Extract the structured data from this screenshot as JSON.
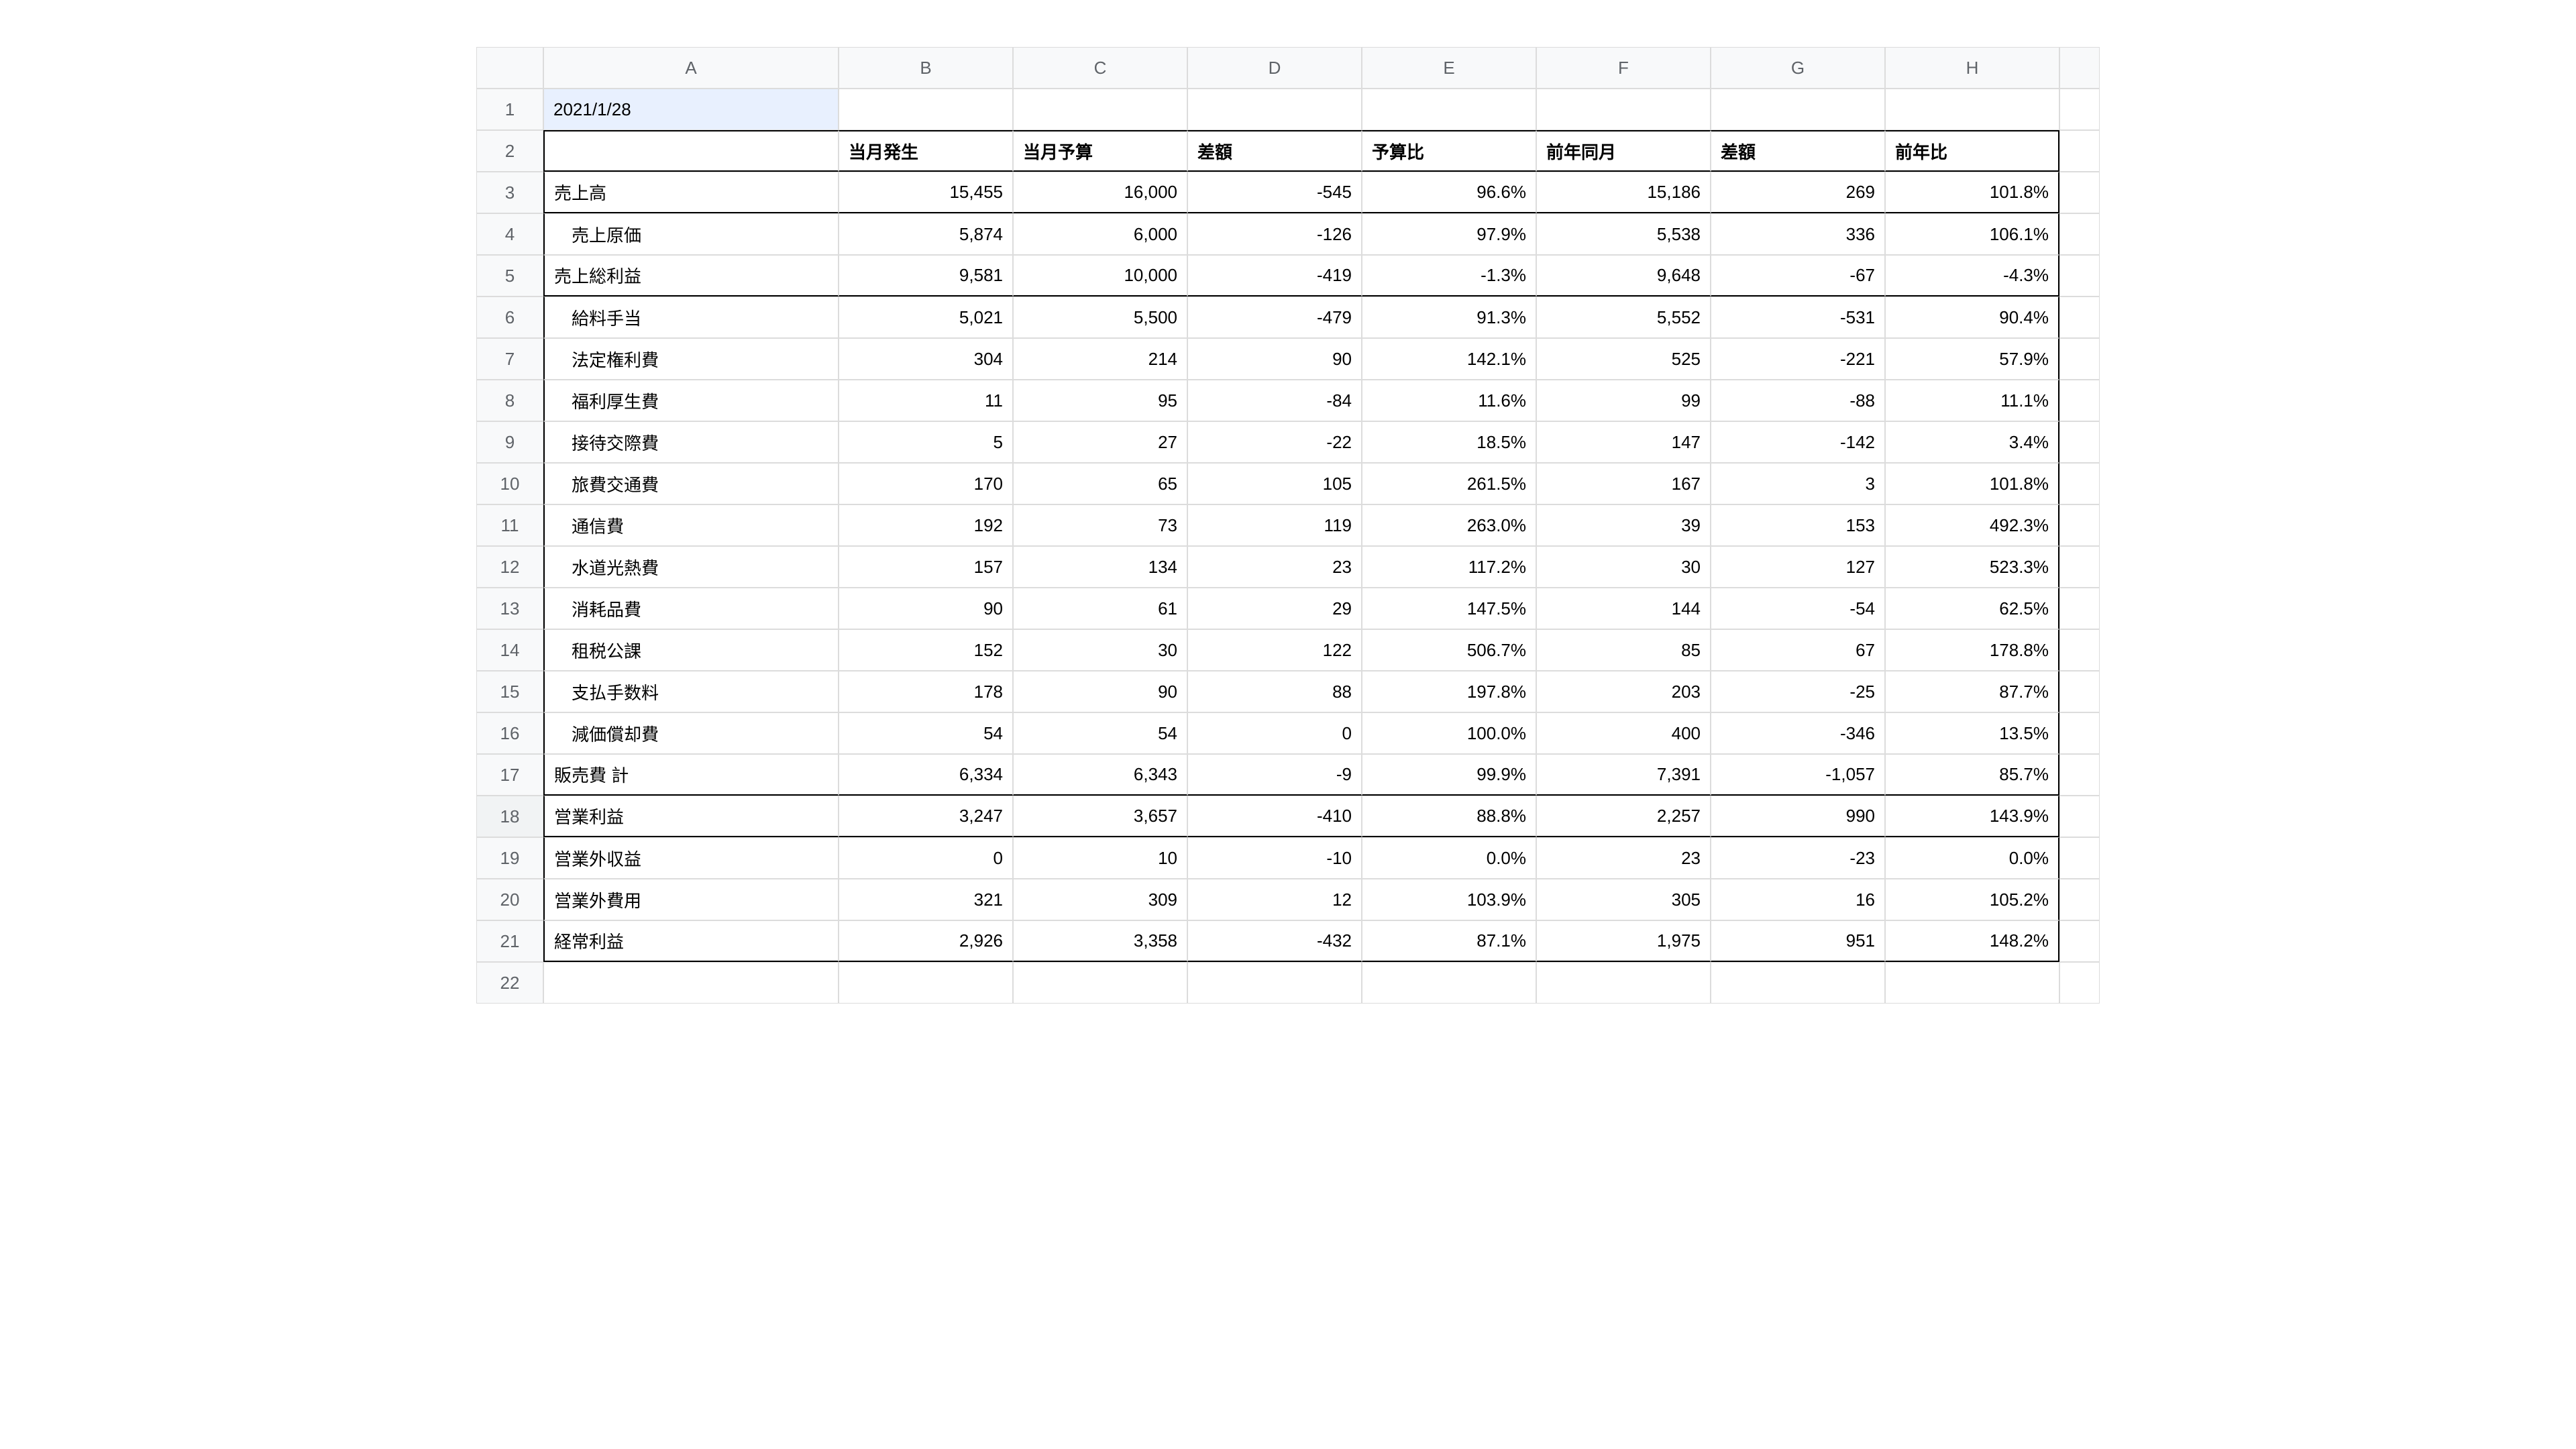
{
  "columns": [
    "",
    "A",
    "B",
    "C",
    "D",
    "E",
    "F",
    "G",
    "H",
    ""
  ],
  "date_cell": "2021/1/28",
  "headers": {
    "a": "",
    "b": "当月発生",
    "c": "当月予算",
    "d": "差額",
    "e": "予算比",
    "f": "前年同月",
    "g": "差額",
    "h": "前年比"
  },
  "rows": [
    {
      "n": "3",
      "label": "売上高",
      "indent": false,
      "b": "15,455",
      "c": "16,000",
      "d": "-545",
      "e": "96.6%",
      "f": "15,186",
      "g": "269",
      "h": "101.8%"
    },
    {
      "n": "4",
      "label": "売上原価",
      "indent": true,
      "b": "5,874",
      "c": "6,000",
      "d": "-126",
      "e": "97.9%",
      "f": "5,538",
      "g": "336",
      "h": "106.1%"
    },
    {
      "n": "5",
      "label": "売上総利益",
      "indent": false,
      "b": "9,581",
      "c": "10,000",
      "d": "-419",
      "e": "-1.3%",
      "f": "9,648",
      "g": "-67",
      "h": "-4.3%"
    },
    {
      "n": "6",
      "label": "給料手当",
      "indent": true,
      "b": "5,021",
      "c": "5,500",
      "d": "-479",
      "e": "91.3%",
      "f": "5,552",
      "g": "-531",
      "h": "90.4%"
    },
    {
      "n": "7",
      "label": "法定権利費",
      "indent": true,
      "b": "304",
      "c": "214",
      "d": "90",
      "e": "142.1%",
      "f": "525",
      "g": "-221",
      "h": "57.9%"
    },
    {
      "n": "8",
      "label": "福利厚生費",
      "indent": true,
      "b": "11",
      "c": "95",
      "d": "-84",
      "e": "11.6%",
      "f": "99",
      "g": "-88",
      "h": "11.1%"
    },
    {
      "n": "9",
      "label": "接待交際費",
      "indent": true,
      "b": "5",
      "c": "27",
      "d": "-22",
      "e": "18.5%",
      "f": "147",
      "g": "-142",
      "h": "3.4%"
    },
    {
      "n": "10",
      "label": "旅費交通費",
      "indent": true,
      "b": "170",
      "c": "65",
      "d": "105",
      "e": "261.5%",
      "f": "167",
      "g": "3",
      "h": "101.8%"
    },
    {
      "n": "11",
      "label": "通信費",
      "indent": true,
      "b": "192",
      "c": "73",
      "d": "119",
      "e": "263.0%",
      "f": "39",
      "g": "153",
      "h": "492.3%"
    },
    {
      "n": "12",
      "label": "水道光熱費",
      "indent": true,
      "b": "157",
      "c": "134",
      "d": "23",
      "e": "117.2%",
      "f": "30",
      "g": "127",
      "h": "523.3%"
    },
    {
      "n": "13",
      "label": "消耗品費",
      "indent": true,
      "b": "90",
      "c": "61",
      "d": "29",
      "e": "147.5%",
      "f": "144",
      "g": "-54",
      "h": "62.5%"
    },
    {
      "n": "14",
      "label": "租税公課",
      "indent": true,
      "b": "152",
      "c": "30",
      "d": "122",
      "e": "506.7%",
      "f": "85",
      "g": "67",
      "h": "178.8%"
    },
    {
      "n": "15",
      "label": "支払手数料",
      "indent": true,
      "b": "178",
      "c": "90",
      "d": "88",
      "e": "197.8%",
      "f": "203",
      "g": "-25",
      "h": "87.7%"
    },
    {
      "n": "16",
      "label": "減価償却費",
      "indent": true,
      "b": "54",
      "c": "54",
      "d": "0",
      "e": "100.0%",
      "f": "400",
      "g": "-346",
      "h": "13.5%"
    },
    {
      "n": "17",
      "label": "販売費 計",
      "indent": false,
      "b": "6,334",
      "c": "6,343",
      "d": "-9",
      "e": "99.9%",
      "f": "7,391",
      "g": "-1,057",
      "h": "85.7%"
    },
    {
      "n": "18",
      "label": "営業利益",
      "indent": false,
      "b": "3,247",
      "c": "3,657",
      "d": "-410",
      "e": "88.8%",
      "f": "2,257",
      "g": "990",
      "h": "143.9%"
    },
    {
      "n": "19",
      "label": "営業外収益",
      "indent": false,
      "b": "0",
      "c": "10",
      "d": "-10",
      "e": "0.0%",
      "f": "23",
      "g": "-23",
      "h": "0.0%"
    },
    {
      "n": "20",
      "label": "営業外費用",
      "indent": false,
      "b": "321",
      "c": "309",
      "d": "12",
      "e": "103.9%",
      "f": "305",
      "g": "16",
      "h": "105.2%"
    },
    {
      "n": "21",
      "label": "経常利益",
      "indent": false,
      "b": "2,926",
      "c": "3,358",
      "d": "-432",
      "e": "87.1%",
      "f": "1,975",
      "g": "951",
      "h": "148.2%"
    }
  ],
  "row_numbers_extra": [
    "22"
  ]
}
